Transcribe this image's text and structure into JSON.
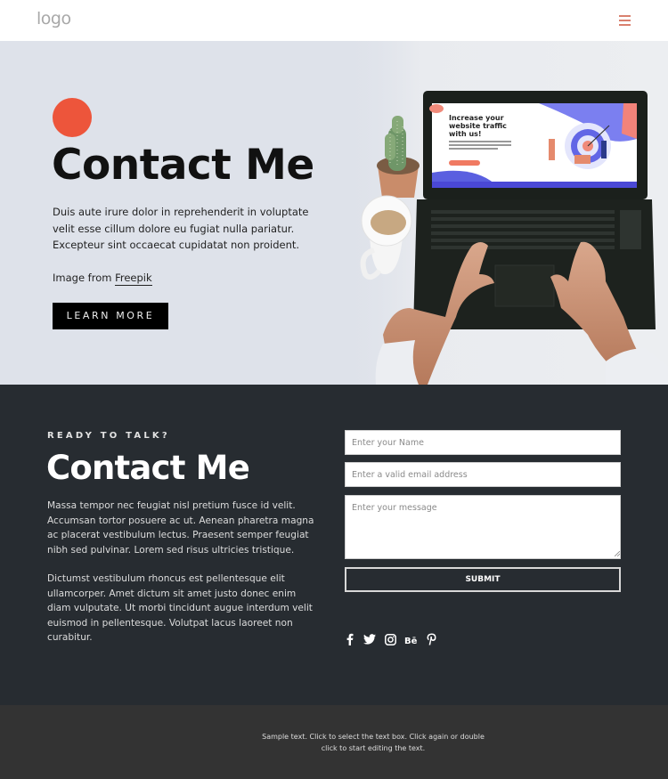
{
  "header": {
    "logo_text": "logo",
    "menu_icon": "hamburger-menu-icon",
    "accent_color": "#d9806e"
  },
  "hero": {
    "accent_dot_color": "#ed553b",
    "title": "Contact Me",
    "text": "Duis aute irure dolor in reprehenderit in voluptate velit esse cillum dolore eu fugiat nulla pariatur. Excepteur sint occaecat cupidatat non proident.",
    "credit_prefix": "Image from ",
    "credit_link": "Freepik",
    "button_label": "LEARN MORE",
    "image": {
      "description": "Hands typing on a laptop beside a cactus and a coffee mug",
      "screen_headline": "Increase your website traffic with us!"
    }
  },
  "contact": {
    "eyebrow": "READY TO TALK?",
    "title": "Contact Me",
    "paragraph_1": "Massa tempor nec feugiat nisl pretium fusce id velit. Accumsan tortor posuere ac ut. Aenean pharetra magna ac placerat vestibulum lectus. Praesent semper feugiat nibh sed pulvinar. Lorem sed risus ultricies tristique.",
    "paragraph_2": "Dictumst vestibulum rhoncus est pellentesque elit ullamcorper. Amet dictum sit amet justo donec enim diam vulputate. Ut morbi tincidunt augue interdum velit euismod in pellentesque. Volutpat lacus laoreet non curabitur.",
    "form": {
      "name_placeholder": "Enter your Name",
      "name_value": "",
      "email_placeholder": "Enter a valid email address",
      "email_value": "",
      "message_placeholder": "Enter your message",
      "message_value": "",
      "submit_label": "SUBMIT"
    },
    "socials": [
      {
        "name": "facebook",
        "icon": "facebook-icon"
      },
      {
        "name": "twitter",
        "icon": "twitter-icon"
      },
      {
        "name": "instagram",
        "icon": "instagram-icon"
      },
      {
        "name": "behance",
        "icon": "behance-icon"
      },
      {
        "name": "pinterest",
        "icon": "pinterest-icon"
      }
    ],
    "background_color": "#272c31"
  },
  "footer": {
    "text": "Sample text. Click to select the text box. Click again or double click to start editing the text.",
    "background_color": "#333333"
  }
}
